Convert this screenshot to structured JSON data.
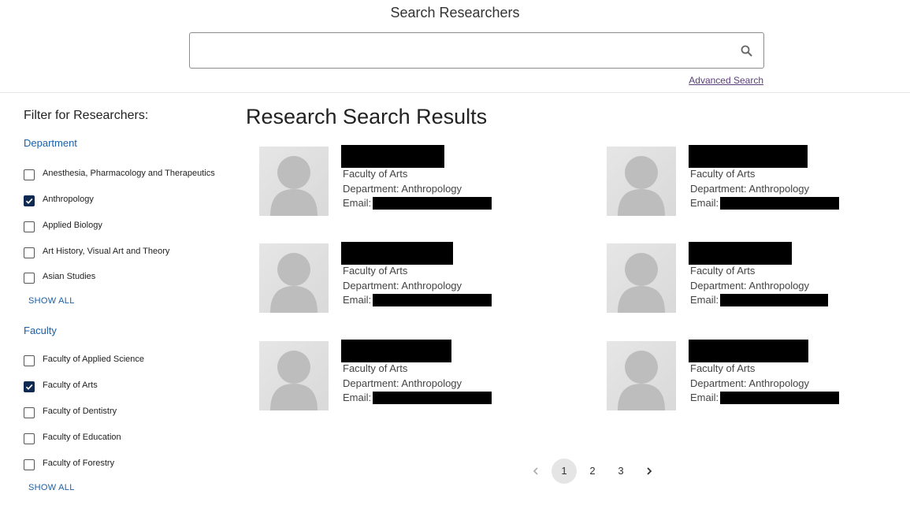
{
  "header": {
    "title": "Search Researchers",
    "search_value": "",
    "search_placeholder": "",
    "advanced_search_label": "Advanced Search"
  },
  "sidebar": {
    "heading": "Filter for Researchers:",
    "groups": [
      {
        "heading": "Department",
        "items": [
          {
            "label": "Anesthesia, Pharmacology and Therapeutics",
            "checked": false
          },
          {
            "label": "Anthropology",
            "checked": true
          },
          {
            "label": "Applied Biology",
            "checked": false
          },
          {
            "label": "Art History, Visual Art and Theory",
            "checked": false
          },
          {
            "label": "Asian Studies",
            "checked": false
          }
        ],
        "show_all_label": "SHOW ALL"
      },
      {
        "heading": "Faculty",
        "items": [
          {
            "label": "Faculty of Applied Science",
            "checked": false
          },
          {
            "label": "Faculty of Arts",
            "checked": true
          },
          {
            "label": "Faculty of Dentistry",
            "checked": false
          },
          {
            "label": "Faculty of Education",
            "checked": false
          },
          {
            "label": "Faculty of Forestry",
            "checked": false
          }
        ],
        "show_all_label": "SHOW ALL"
      }
    ]
  },
  "results": {
    "title": "Research Search Results",
    "cards": [
      {
        "faculty": "Faculty of Arts",
        "department": "Department: Anthropology",
        "email_label": "Email:",
        "name_redacted": true,
        "email_redacted": true
      },
      {
        "faculty": "Faculty of Arts",
        "department": "Department: Anthropology",
        "email_label": "Email:",
        "name_redacted": true,
        "email_redacted": true
      },
      {
        "faculty": "Faculty of Arts",
        "department": "Department: Anthropology",
        "email_label": "Email:",
        "name_redacted": true,
        "email_redacted": true
      },
      {
        "faculty": "Faculty of Arts",
        "department": "Department: Anthropology",
        "email_label": "Email:",
        "name_redacted": true,
        "email_redacted": true
      },
      {
        "faculty": "Faculty of Arts",
        "department": "Department: Anthropology",
        "email_label": "Email:",
        "name_redacted": true,
        "email_redacted": true
      },
      {
        "faculty": "Faculty of Arts",
        "department": "Department: Anthropology",
        "email_label": "Email:",
        "name_redacted": true,
        "email_redacted": true
      }
    ]
  },
  "pagination": {
    "prev_icon": "chevron-left-icon",
    "next_icon": "chevron-right-icon",
    "pages": [
      "1",
      "2",
      "3"
    ],
    "current": "1"
  },
  "colors": {
    "link": "#1a5fa8",
    "checkbox_checked": "#0f2a52",
    "advanced_link": "#5a3d7a",
    "redaction": "#000000"
  }
}
